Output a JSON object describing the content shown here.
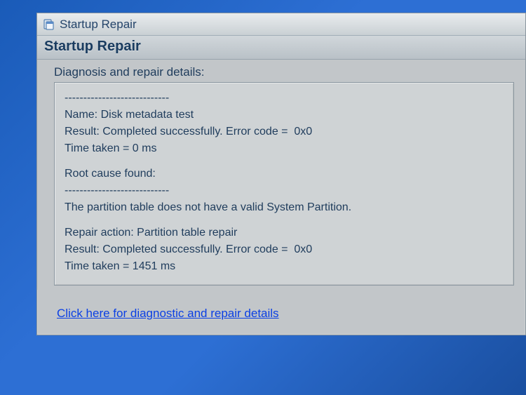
{
  "window": {
    "title": "Startup Repair"
  },
  "header": {
    "heading": "Startup Repair"
  },
  "section_label": "Diagnosis and repair details:",
  "divider": "----------------------------",
  "test": {
    "name_label": "Name:",
    "name_value": "Disk metadata test",
    "result_label": "Result:",
    "result_value": "Completed successfully. Error code =  0x0",
    "time_label": "Time taken =",
    "time_value": "0 ms"
  },
  "root_cause": {
    "title": "Root cause found:",
    "text": "The partition table does not have a valid System Partition."
  },
  "repair": {
    "action_label": "Repair action:",
    "action_value": "Partition table repair",
    "result_label": "Result:",
    "result_value": "Completed successfully. Error code =  0x0",
    "time_label": "Time taken =",
    "time_value": "1451 ms"
  },
  "link_text": "Click here for diagnostic and repair details"
}
